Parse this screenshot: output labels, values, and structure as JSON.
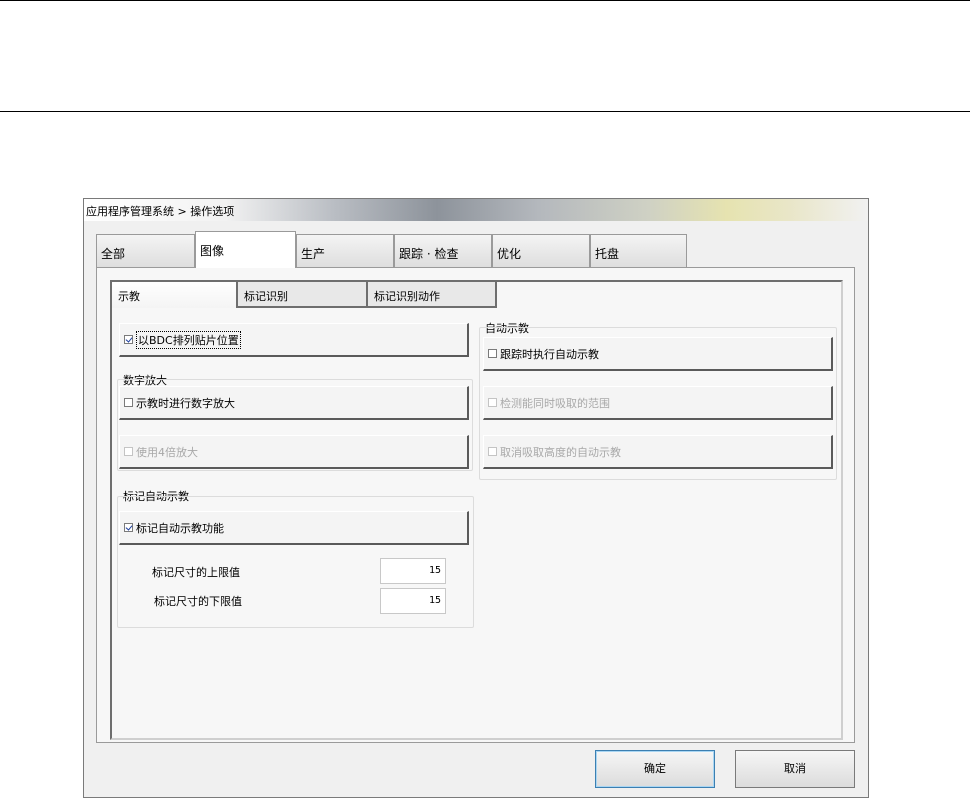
{
  "window": {
    "title": "应用程序管理系统 > 操作选项"
  },
  "outer_tabs": [
    {
      "label": "全部"
    },
    {
      "label": "图像"
    },
    {
      "label": "生产"
    },
    {
      "label": "跟踪 · 检查"
    },
    {
      "label": "优化"
    },
    {
      "label": "托盘"
    }
  ],
  "inner_tabs": [
    {
      "label": "示教"
    },
    {
      "label": "标记识别"
    },
    {
      "label": "标记识别动作"
    }
  ],
  "left": {
    "arrange_bdc": {
      "label": "以BDC排列贴片位置",
      "checked": true
    },
    "digital_zoom_group": "数字放大",
    "digital_zoom_teach": {
      "label": "示教时进行数字放大",
      "checked": false
    },
    "use_4x_zoom": {
      "label": "使用4倍放大",
      "checked": false,
      "enabled": false
    },
    "mark_auto_teach_group": "标记自动示教",
    "mark_auto_teach": {
      "label": "标记自动示教功能",
      "checked": true
    },
    "mark_size_upper_label": "标记尺寸的上限值",
    "mark_size_upper_value": "15",
    "mark_size_lower_label": "标记尺寸的下限值",
    "mark_size_lower_value": "15"
  },
  "right": {
    "auto_teach_group": "自动示教",
    "tracking_auto_teach": {
      "label": "跟踪时执行自动示教",
      "checked": false
    },
    "detect_pickup_range": {
      "label": "检测能同时吸取的范围",
      "checked": false,
      "enabled": false
    },
    "cancel_pickup_height": {
      "label": "取消吸取高度的自动示教",
      "checked": false,
      "enabled": false
    }
  },
  "buttons": {
    "ok": "确定",
    "cancel": "取消"
  }
}
